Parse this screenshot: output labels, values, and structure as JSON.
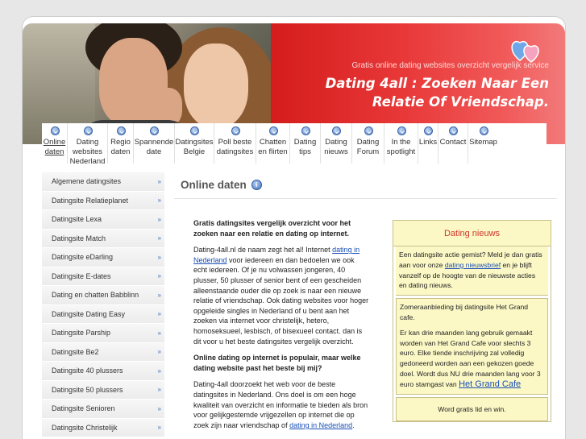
{
  "header": {
    "tagline": "Gratis online dating websites overzicht vergelijk service",
    "title": "Dating 4all : Zoeken Naar Een Relatie Of Vriendschap."
  },
  "nav": [
    {
      "label": "Online daten",
      "active": true
    },
    {
      "label": "Dating websites Nederland"
    },
    {
      "label": "Regio daten"
    },
    {
      "label": "Spannende date"
    },
    {
      "label": "Datingsites Belgie"
    },
    {
      "label": "Poll beste datingsites"
    },
    {
      "label": "Chatten en flirten"
    },
    {
      "label": "Dating tips"
    },
    {
      "label": "Dating nieuws"
    },
    {
      "label": "Dating Forum"
    },
    {
      "label": "In the spotlight"
    },
    {
      "label": "Links"
    },
    {
      "label": "Contact"
    },
    {
      "label": "Sitemap"
    }
  ],
  "sidebar": [
    "Algemene datingsites",
    "Datingsite Relatieplanet",
    "Datingsite Lexa",
    "Datingsite Match",
    "Datingsite eDarling",
    "Datingsite E-dates",
    "Dating en chatten Babblinn",
    "Datingsite Dating Easy",
    "Datingsite Parship",
    "Datingsite Be2",
    "Datingsite 40 plussers",
    "Datingsite 50 plussers",
    "Datingsite Senioren",
    "Datingsite Christelijk"
  ],
  "main": {
    "heading": "Online daten",
    "intro": "Gratis datingsites vergelijk overzicht voor het zoeken naar een relatie en dating op internet.",
    "p1_start": "Dating-4all.nl de naam zegt het al! Internet ",
    "p1_link": "dating in Nederland",
    "p1_rest": " voor iedereen en dan bedoelen we ook echt iedereen. Of je nu volwassen jongeren, 40 plusser, 50 plusser of senior bent of een gescheiden alleenstaande ouder die op zoek is naar een nieuwe relatie of vriendschap. Ook dating websites voor hoger opgeleide singles in Nederland of u bent aan het zoeken via internet voor christelijk, hetero, homoseksueel, lesbisch, of bisexueel contact. dan is dit voor u het beste datingsites vergelijk overzicht.",
    "q": "Online dating op internet is populair, maar welke dating website past het beste bij mij?",
    "p2_start": "Dating-4all doorzoekt het web voor de beste datingsites in Nederland. Ons doel is om een hoge kwaliteit van overzicht en informatie te bieden als bron voor gelijkgestemde vrijgezellen op internet die op zoek zijn naar vriendschap of ",
    "p2_link": "dating in Nederland",
    "p2_rest": "."
  },
  "news": {
    "title": "Dating nieuws",
    "b1_start": "Een datingsite actie gemist? Meld je dan gratis aan voor onze ",
    "b1_link": "dating nieuwsbrief",
    "b1_rest": " en je blijft vanzelf op de hoogte van de nieuwste acties en dating nieuws.",
    "b2_head": "Zomeraanbieding bij datingsite Het Grand cafe.",
    "b2_text": "Er kan drie maanden lang gebruik gemaakt worden van Het Grand Cafe voor slechts 3 euro. Elke tiende inschrijving zal volledig gedoneerd worden aan een gekozen goede doel. Wordt dus NU drie maanden lang voor 3 euro stamgast van ",
    "b2_link": "Het Grand Cafe",
    "b3": "Word gratis lid en win."
  },
  "colors": {
    "banner": "#e02a2a",
    "link": "#1a4fb5",
    "news_bg": "#fbf8c6"
  }
}
